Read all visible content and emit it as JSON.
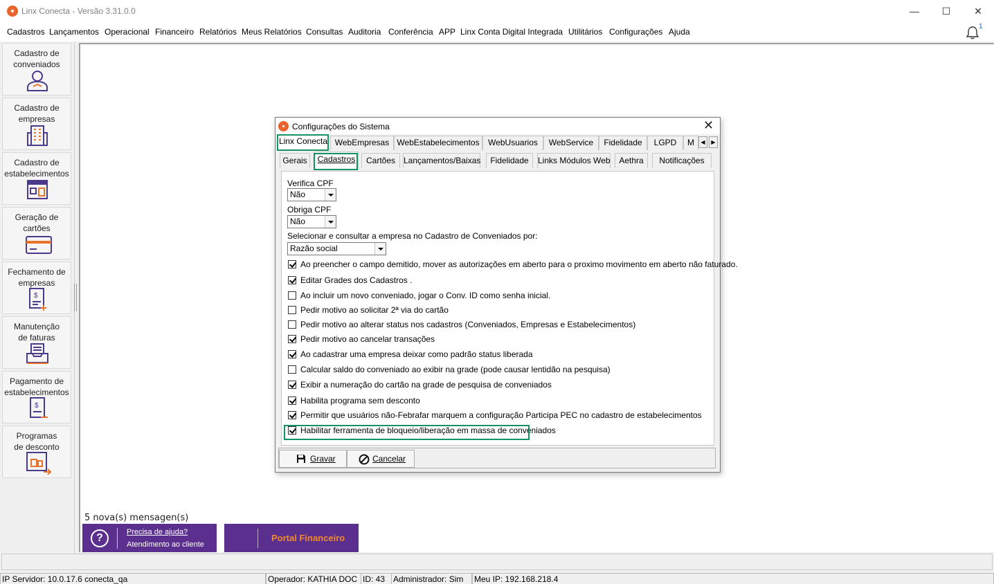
{
  "window": {
    "title": "Linx Conecta - Versão 3.31.0.0",
    "minimize": "—",
    "maximize": "☐",
    "close": "✕"
  },
  "menu": [
    "Cadastros",
    "Lançamentos",
    "Operacional",
    "Financeiro",
    "Relatórios",
    "Meus Relatórios",
    "Consultas",
    "Auditoria",
    "Conferência",
    "APP",
    "Linx Conta Digital Integrada",
    "Utilitários",
    "Configurações",
    "Ajuda"
  ],
  "notifications": {
    "count": "1",
    "icon": "bell-icon"
  },
  "sidebar": [
    {
      "label": "Cadastro de\nconveniados",
      "icon": "user-icon"
    },
    {
      "label": "Cadastro de\nempresas",
      "icon": "building-icon"
    },
    {
      "label": "Cadastro de\nestabelecimentos",
      "icon": "store-icon"
    },
    {
      "label": "Geração de\ncartões",
      "icon": "card-icon"
    },
    {
      "label": "Fechamento de\nempresas",
      "icon": "invoice-icon"
    },
    {
      "label": "Manutenção\nde faturas",
      "icon": "tray-icon"
    },
    {
      "label": "Pagamento de\nestabelecimentos",
      "icon": "payment-icon"
    },
    {
      "label": "Programas\nde desconto",
      "icon": "discount-icon"
    }
  ],
  "messages": "5 nova(s) mensagen(s)",
  "help_banner": {
    "line1": "Precisa de ajuda?",
    "line2": "Atendimento ao cliente",
    "icon": "question-icon"
  },
  "portal_banner": {
    "label": "Portal Financeiro"
  },
  "status": {
    "server": "IP Servidor: 10.0.17.6 conecta_qa",
    "operator": "Operador: KATHIA DOC",
    "id": "ID: 43",
    "admin": "Administrador: Sim",
    "ip": "Meu IP: 192.168.218.4"
  },
  "dialog": {
    "title": "Configurações do Sistema",
    "tabs_top": [
      "Linx Conecta",
      "WebEmpresas",
      "WebEstabelecimentos",
      "WebUsuarios",
      "WebService",
      "Fidelidade",
      "LGPD",
      "M"
    ],
    "active_top": "Linx Conecta",
    "tabs_sub": [
      "Gerais",
      "Cadastros",
      "Cartões",
      "Lançamentos/Baixas",
      "Fidelidade",
      "Links Módulos Web",
      "Aethra",
      "Notificações"
    ],
    "active_sub": "Cadastros",
    "fields": {
      "verifica_cpf": {
        "label": "Verifica CPF",
        "value": "Não"
      },
      "obriga_cpf": {
        "label": "Obriga CPF",
        "value": "Não"
      },
      "selecionar": {
        "label": "Selecionar e consultar a empresa no Cadastro de Conveniados por:",
        "value": "Razão social"
      }
    },
    "checkboxes": [
      {
        "label": "Ao preencher o campo demitido, mover as autorizações em aberto para o proximo movimento em aberto não faturado.",
        "checked": true
      },
      {
        "label": "Editar Grades dos Cadastros .",
        "checked": true
      },
      {
        "label": "Ao incluir um novo conveniado, jogar o Conv. ID como senha inicial.",
        "checked": false
      },
      {
        "label": "Pedir motivo ao solicitar 2ª via do cartão",
        "checked": false
      },
      {
        "label": "Pedir motivo ao alterar status nos cadastros (Conveniados, Empresas e Estabelecimentos)",
        "checked": false
      },
      {
        "label": "Pedir motivo ao cancelar transações",
        "checked": true
      },
      {
        "label": "Ao cadastrar uma empresa deixar como padrão status liberada",
        "checked": true
      },
      {
        "label": "Calcular saldo do conveniado ao exibir na grade (pode causar lentidão na pesquisa)",
        "checked": false
      },
      {
        "label": "Exibir a numeração do cartão na grade de pesquisa de conveniados",
        "checked": true
      },
      {
        "label": "Habilita programa sem desconto",
        "checked": true
      },
      {
        "label": "Permitir que usuários não-Febrafar marquem a configuração Participa PEC no cadastro de estabelecimentos",
        "checked": true
      },
      {
        "label": "Habilitar ferramenta de bloqueio/liberação em massa de conveniados",
        "checked": true
      }
    ],
    "buttons": {
      "save": "Gravar",
      "cancel": "Cancelar"
    },
    "highlight_color": "#14925f"
  }
}
